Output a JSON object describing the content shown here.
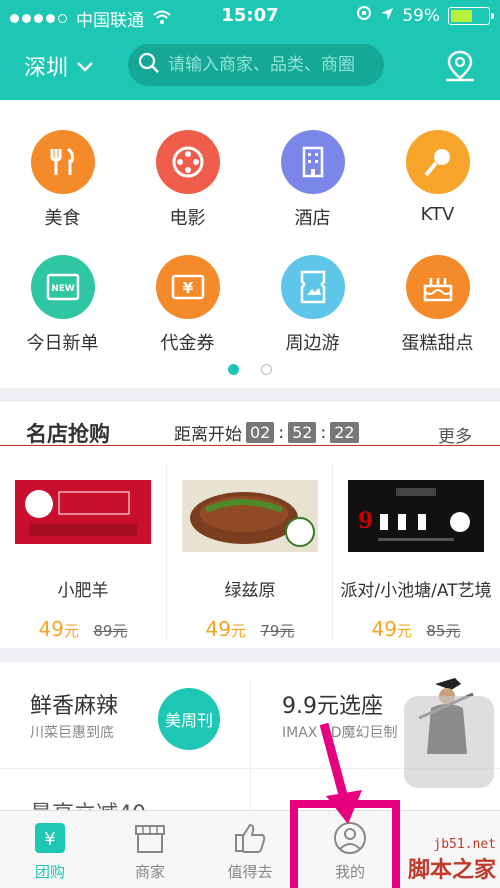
{
  "status_bar": {
    "carrier": "中国联通",
    "time": "15:07",
    "battery": "59%"
  },
  "header": {
    "city": "深圳",
    "search_placeholder": "请输入商家、品类、商圈"
  },
  "categories": [
    {
      "label": "美食",
      "color": "#f58a2a",
      "icon": "cutlery-icon"
    },
    {
      "label": "电影",
      "color": "#ef5e4a",
      "icon": "film-reel-icon"
    },
    {
      "label": "酒店",
      "color": "#7b87e8",
      "icon": "building-icon"
    },
    {
      "label": "KTV",
      "color": "#f7a52a",
      "icon": "microphone-icon"
    },
    {
      "label": "今日新单",
      "color": "#2fc6a4",
      "icon": "new-badge-icon"
    },
    {
      "label": "代金券",
      "color": "#f58a2a",
      "icon": "voucher-icon"
    },
    {
      "label": "周边游",
      "color": "#5fc6ea",
      "icon": "ticket-icon"
    },
    {
      "label": "蛋糕甜点",
      "color": "#f58a2a",
      "icon": "cake-icon"
    }
  ],
  "flash_sale": {
    "title": "名店抢购",
    "countdown_label": "距离开始",
    "hours": "02",
    "minutes": "52",
    "seconds": "22",
    "more": "更多",
    "products": [
      {
        "name": "小肥羊",
        "price": "49",
        "unit": "元",
        "old_price": "89元"
      },
      {
        "name": "绿兹原",
        "price": "49",
        "unit": "元",
        "old_price": "79元"
      },
      {
        "name": "派对/小池塘/AT艺境",
        "price": "49",
        "unit": "元",
        "old_price": "85元"
      }
    ]
  },
  "promos": {
    "left_title": "鲜香麻辣",
    "left_sub": "川菜巨惠到底",
    "badge": "美周刊",
    "right_title": "9.9元选座",
    "right_sub": "IMAX 3D魔幻巨制",
    "bottom_left": "最高立减40"
  },
  "tabs": [
    {
      "label": "团购",
      "icon": "groupbuy-icon",
      "active": true
    },
    {
      "label": "商家",
      "icon": "store-icon",
      "active": false
    },
    {
      "label": "值得去",
      "icon": "thumbs-up-icon",
      "active": false
    },
    {
      "label": "我的",
      "icon": "profile-icon",
      "active": false
    }
  ],
  "watermark": {
    "site": "jb51.net",
    "name": "脚本之家"
  },
  "colors": {
    "brand": "#1ec7b3",
    "price": "#f5a623",
    "highlight": "#e6007e"
  }
}
